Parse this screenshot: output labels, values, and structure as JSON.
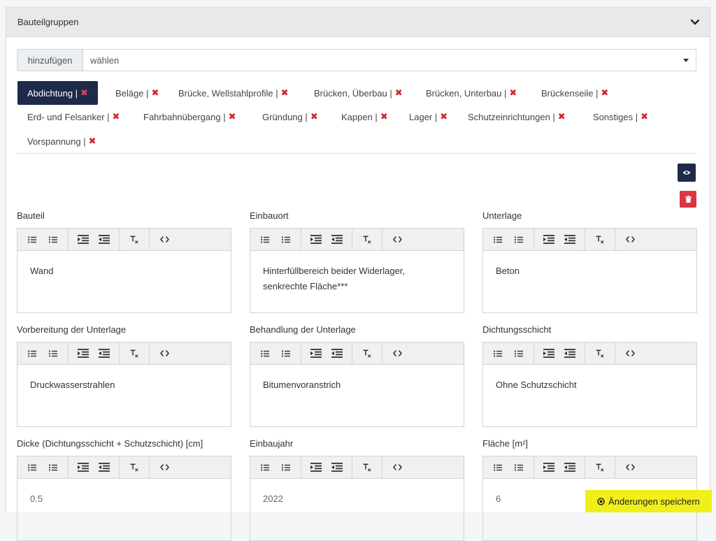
{
  "panel": {
    "title": "Bauteilgruppen"
  },
  "selector": {
    "addon_label": "hinzufügen",
    "selected": "wählen"
  },
  "tags": [
    {
      "label": "Abdichtung |"
    },
    {
      "label": "Beläge |"
    },
    {
      "label": "Brücke, Wellstahlprofile |"
    },
    {
      "label": "Brücken, Überbau |"
    },
    {
      "label": "Brücken, Unterbau |"
    },
    {
      "label": "Brückenseile |"
    },
    {
      "label": "Erd- und Felsanker |"
    },
    {
      "label": "Fahrbahnübergang |"
    },
    {
      "label": "Gründung |"
    },
    {
      "label": "Kappen |"
    },
    {
      "label": "Lager |"
    },
    {
      "label": "Schutzeinrichtungen |"
    },
    {
      "label": "Sonstiges |"
    },
    {
      "label": "Vorspannung |"
    }
  ],
  "tag_remove_glyph": "✖",
  "fields": [
    {
      "label": "Bauteil",
      "value": "Wand"
    },
    {
      "label": "Einbauort",
      "value": "Hinterfüllbereich beider Widerlager, senkrechte Fläche***"
    },
    {
      "label": "Unterlage",
      "value": "Beton"
    },
    {
      "label": "Vorbereitung der Unterlage",
      "value": "Druckwasserstrahlen"
    },
    {
      "label": "Behandlung der Unterlage",
      "value": "Bitumenvoranstrich"
    },
    {
      "label": "Dichtungsschicht",
      "value": "Ohne Schutzschicht"
    },
    {
      "label": "Dicke (Dichtungsschicht + Schutzschicht) [cm]",
      "value": "0.5"
    },
    {
      "label": "Einbaujahr",
      "value": "2022"
    },
    {
      "label": "Fläche [m²]",
      "value": "6"
    }
  ],
  "actions": {
    "save_label": "Änderungen speichern"
  },
  "colors": {
    "primary": "#1d2a4a",
    "danger": "#dc3545",
    "save": "#f0ef1a",
    "remove": "#d9232d"
  }
}
